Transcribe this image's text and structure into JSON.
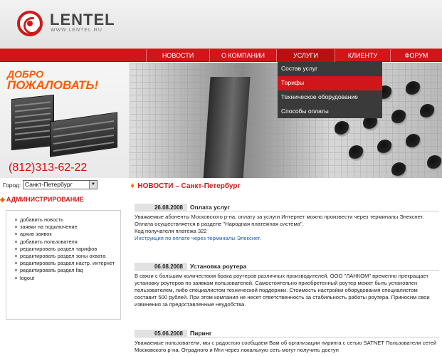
{
  "logo": {
    "name": "LENTEL",
    "url": "WWW.LENTEL.RU"
  },
  "nav": {
    "items": [
      "НОВОСТИ",
      "О КОМПАНИИ",
      "УСЛУГИ",
      "КЛИЕНТУ",
      "ФОРУМ"
    ],
    "active": "УСЛУГИ"
  },
  "dropdown": {
    "items": [
      "Состав услуг",
      "Тарифы",
      "Техническое оборудование",
      "Способы оплаты"
    ],
    "selected": "Тарифы"
  },
  "banner": {
    "welcome_line1": "ДОБРО",
    "welcome_line2": "ПОЖАЛОВАТЬ!",
    "phone": "(812)313-62-22"
  },
  "city": {
    "label": "Город:",
    "value": "Санкт-Петербург"
  },
  "admin": {
    "title": "АДМИНИСТРИРОВАНИЕ",
    "items": [
      "добавить новость",
      "заявки на подключение",
      "архив заявок",
      "добавить пользователя",
      "редактировать раздел тарифов",
      "редактировать раздел зоны охвата",
      "редактировать раздел настр. интернет",
      "редактировать раздел faq",
      "logout"
    ]
  },
  "news": {
    "heading": "НОВОСТИ – Санкт-Петербург",
    "items": [
      {
        "date": "26.08.2008",
        "title": "Оплата услуг",
        "body": "Уважаемые абоненты Московского р-на, оплату за услуги Интернет можно произвести через терминалы Элекснет.",
        "body2": "Оплата осуществляется в разделе \"Народная платежная система\".",
        "body3": "Код получателя платежа 322",
        "link": "Инструкция по оплате через терминалы Элекснет."
      },
      {
        "date": "06.08.2008",
        "title": "Установка роутера",
        "body": "В связи с большим количеством брака роутеров различных производителей, ООО \"ЛАНКОМ\" временно прекращает установку роутеров по заявкам пользователей. Самостоятельно приобретенный роутер может быть установлен пользователем, либо специалистом технической поддержки. Стоимость настройки оборудования специалистом составит 500 рублей. При этом компания не несет ответственность за стабильность работы роутера. Приносим свои извинения за предоставленные неудобства."
      },
      {
        "date": "05.06.2008",
        "title": "Пиринг",
        "body": "Уважаемые пользователи, мы с радостью сообщаем Вам об организации пиринга с сетью SATNET Пользователи сетей Московского р-на, Отрадного и Мги через локальную сеть могут получить доступ"
      }
    ]
  },
  "colors": {
    "brand_red": "#d0161b",
    "accent_orange": "#ff5a00",
    "link_blue": "#1d5bb0",
    "dropdown_bg": "#3a3a3a"
  }
}
